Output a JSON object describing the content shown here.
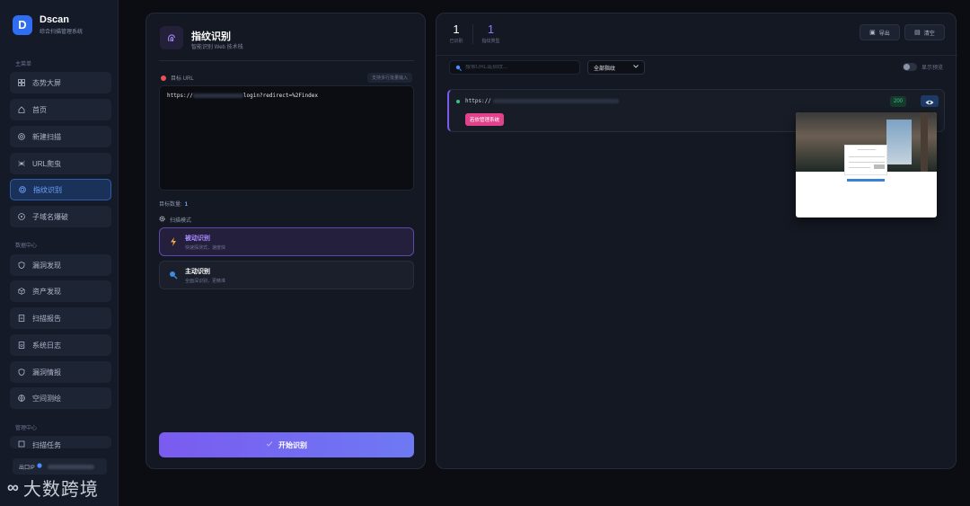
{
  "brand": {
    "logo_letter": "D",
    "name": "Dscan",
    "subtitle": "综合扫描管理系统"
  },
  "sidebar": {
    "main_label": "主菜单",
    "main_items": [
      {
        "label": "态势大屏",
        "icon": "grid-icon"
      },
      {
        "label": "首页",
        "icon": "home-icon"
      },
      {
        "label": "新建扫描",
        "icon": "radar-icon"
      },
      {
        "label": "URL爬虫",
        "icon": "spider-icon"
      },
      {
        "label": "指纹识别",
        "icon": "fingerprint-icon",
        "active": true
      },
      {
        "label": "子域名爆破",
        "icon": "target-icon"
      }
    ],
    "data_label": "数据中心",
    "data_items": [
      {
        "label": "漏洞发现",
        "icon": "shield-icon"
      },
      {
        "label": "资产发现",
        "icon": "cube-icon"
      },
      {
        "label": "扫描报告",
        "icon": "report-icon"
      },
      {
        "label": "系统日志",
        "icon": "log-icon"
      },
      {
        "label": "漏洞情报",
        "icon": "shield-icon"
      },
      {
        "label": "空间测绘",
        "icon": "globe-icon"
      }
    ],
    "manage_label": "管理中心",
    "manage_items": [
      {
        "label": "扫描任务",
        "icon": "task-icon"
      }
    ],
    "ip_label": "出口IP"
  },
  "watermark": {
    "mark": "∞",
    "text": "大数跨境"
  },
  "left_panel": {
    "title": "指纹识别",
    "subtitle": "智能识别 Web 技术栈",
    "url_label": "目标 URL",
    "batch_hint": "支持多行批量输入",
    "url_prefix": "https://",
    "url_suffix": "login?redirect=%2Findex",
    "count_label": "目标数量:",
    "count_value": "1",
    "mode_label": "扫描模式",
    "modes": [
      {
        "title": "被动识别",
        "desc": "快速探测式，速度快"
      },
      {
        "title": "主动识别",
        "desc": "全面深识别，更精准"
      }
    ],
    "start_button": "开始识别"
  },
  "right_panel": {
    "stats": [
      {
        "value": "1",
        "label": "已识别"
      },
      {
        "value": "1",
        "label": "指纹类型"
      }
    ],
    "export_label": "导出",
    "clear_label": "清空",
    "search_placeholder": "搜索URL或指纹...",
    "filter_selected": "全部指纹",
    "preview_toggle_label": "显示预览",
    "result": {
      "url_prefix": "https://",
      "tag": "若依管理系统",
      "status": "200"
    }
  },
  "colors": {
    "accent": "#7a5bf0",
    "active_nav": "#6ea8ff",
    "success": "#36c48a",
    "tag": "#e0428c"
  }
}
